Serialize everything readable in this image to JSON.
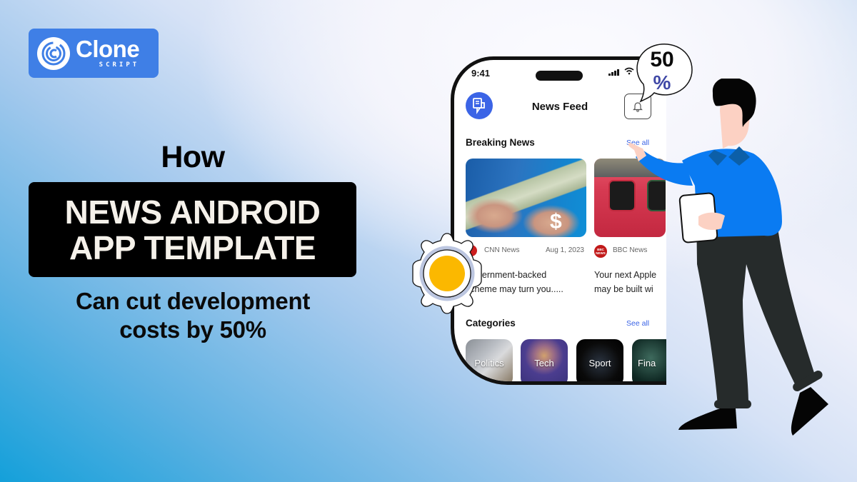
{
  "brand": {
    "name": "Clone",
    "tagline": "SCRIPT",
    "color": "#3f7fe6"
  },
  "headline": {
    "intro": "How",
    "title_lines": [
      "NEWS ANDROID",
      "APP TEMPLATE"
    ],
    "subtitle_lines": [
      "Can cut development",
      "costs by 50%"
    ]
  },
  "phone": {
    "status_time": "9:41",
    "app_title": "News Feed",
    "app_icon": "news-document-icon",
    "bell_icon": "bell-icon",
    "accent_color": "#3b64e6",
    "breaking": {
      "title": "Breaking News",
      "see_all": "See all",
      "cards": [
        {
          "image": "cash-hands-image",
          "image_overlay": "$",
          "source": "CNN News",
          "date": "Aug 1, 2023",
          "headline_lines": [
            "Government-backed",
            "scheme may turn you....."
          ]
        },
        {
          "image": "apple-watch-image",
          "source": "BBC News",
          "source_badge": "BBC NEWS",
          "headline_lines": [
            "Your next Apple",
            "may be built wi"
          ]
        }
      ]
    },
    "categories": {
      "title": "Categories",
      "see_all": "See all",
      "items": [
        {
          "label": "Politics"
        },
        {
          "label": "Tech"
        },
        {
          "label": "Sport"
        },
        {
          "label": "Fina"
        }
      ]
    }
  },
  "badge": {
    "number": "50",
    "symbol": "%",
    "symbol_color": "#3f48a6"
  },
  "illustration": {
    "gear_center_color": "#fbb800",
    "person_shirt_color": "#0a7bf2",
    "person_pants_color": "#262b2b"
  }
}
